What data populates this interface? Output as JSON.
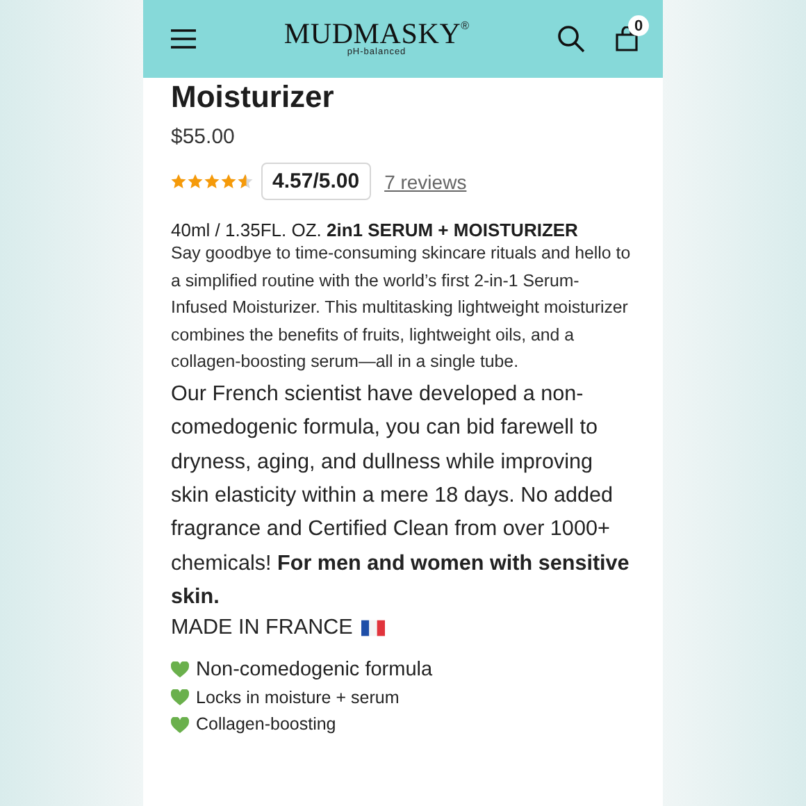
{
  "header": {
    "logo": "MUDMASKY",
    "logo_mark": "®",
    "tagline": "pH-balanced",
    "cart_count": "0"
  },
  "product": {
    "title": "Moisturizer",
    "price": "$55.00",
    "stars": 4.57,
    "rating": "4.57/5.00",
    "reviews_link": "7 reviews",
    "size_line": "40ml / 1.35FL. OZ. **2in1 SERUM + MOISTURIZER**",
    "description": "Say goodbye to time-consuming skincare rituals and hello to a simplified routine with the world’s first 2-in-1 Serum-Infused Moisturizer. This multitasking lightweight moisturizer combines the benefits of fruits, lightweight oils, and a collagen-boosting serum—all in a single tube.",
    "claim": "Our French scientist have developed a non-comedogenic formula, you can bid farewell to dryness, aging, and dullness while improving skin elasticity within a mere 18 days. No added fragrance and Certified Clean from over 1000+ chemicals! **For men and women with sensitive skin.**",
    "origin": "MADE IN FRANCE",
    "features": [
      {
        "text": "Non-comedogenic formula",
        "kind": "large",
        "color": "#6ab04c"
      },
      {
        "text": "Locks in moisture + serum",
        "kind": "small",
        "color": "#6ab04c"
      },
      {
        "text": "Collagen-boosting",
        "kind": "small",
        "color": "#6ab04c"
      }
    ]
  }
}
